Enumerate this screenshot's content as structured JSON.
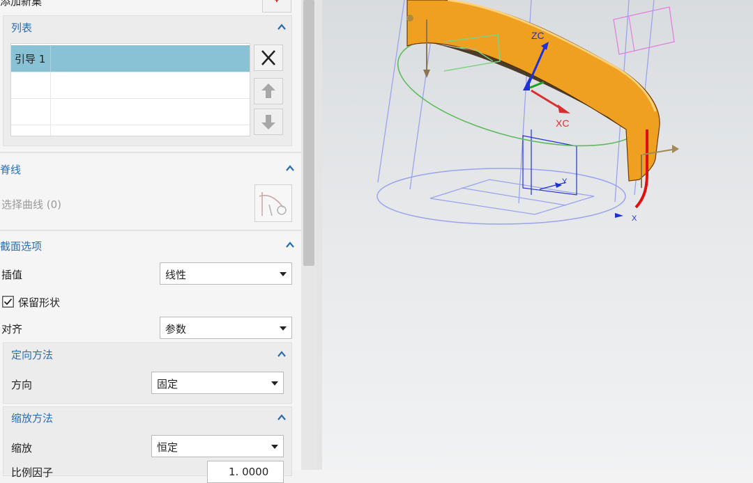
{
  "panel": {
    "top_cut_label": "添加新集",
    "list_section": {
      "title": "列表",
      "rows": [
        {
          "name": "引导 1",
          "selected": true
        },
        {
          "name": "",
          "selected": false
        },
        {
          "name": "",
          "selected": false
        },
        {
          "name": "",
          "selected": false
        }
      ],
      "buttons": [
        "delete-icon",
        "move-up-icon",
        "move-down-icon"
      ]
    },
    "spine_section": {
      "title": "脊线",
      "select_curve_label": "选择曲线 (0)"
    },
    "section_options": {
      "title": "截面选项",
      "interpolation_label": "插值",
      "interpolation_value": "线性",
      "preserve_shape_label": "保留形状",
      "preserve_shape_checked": true,
      "align_label": "对齐",
      "align_value": "参数",
      "orientation": {
        "title": "定向方法",
        "direction_label": "方向",
        "direction_value": "固定"
      },
      "scaling": {
        "title": "缩放方法",
        "scale_label": "缩放",
        "scale_value": "恒定",
        "factor_label": "比例因子",
        "factor_value": "1. 0000"
      }
    }
  },
  "viewport": {
    "axis_labels": {
      "zc": "ZC",
      "xc": "XC",
      "y": "Y",
      "x": "X"
    }
  },
  "colors": {
    "accent": "#2b6cb0",
    "selection": "#89c2d5",
    "model": "#f0a020",
    "guide": "#e01010"
  }
}
